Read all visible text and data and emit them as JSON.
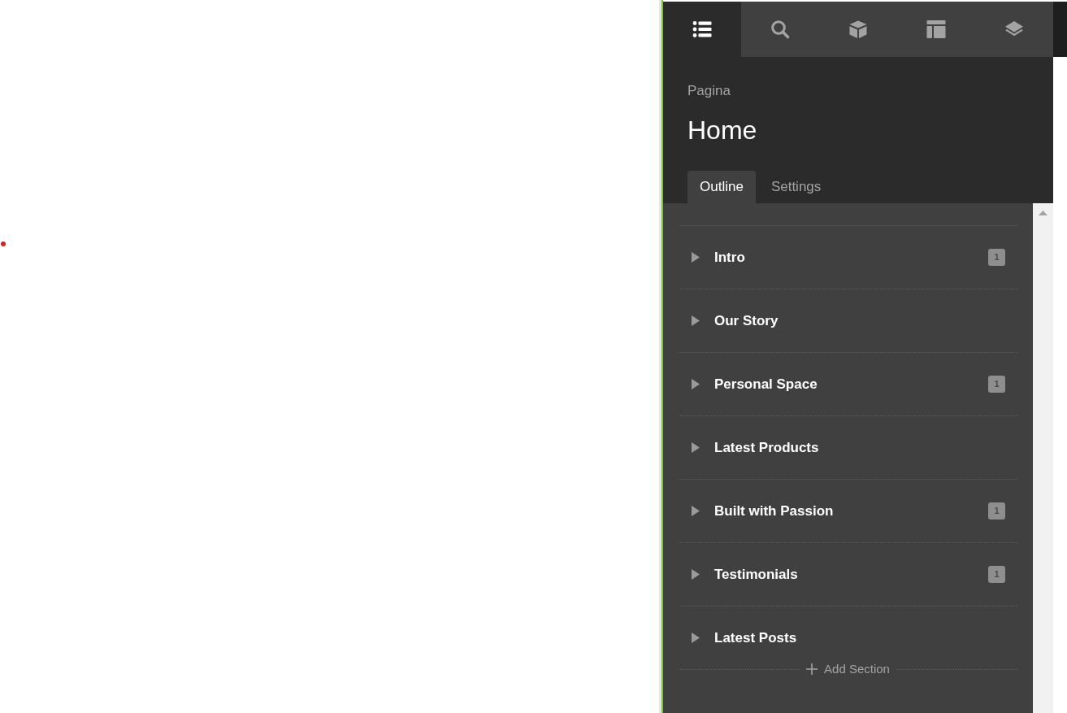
{
  "toolbar": {
    "tabs": [
      {
        "kind": "outline",
        "selected": true
      },
      {
        "kind": "search",
        "selected": false
      },
      {
        "kind": "blocks",
        "selected": false
      },
      {
        "kind": "layout",
        "selected": false
      },
      {
        "kind": "layers",
        "selected": false
      }
    ]
  },
  "header": {
    "label": "Pagina",
    "title": "Home"
  },
  "tabs": [
    {
      "label": "Outline",
      "selected": true
    },
    {
      "label": "Settings",
      "selected": false
    }
  ],
  "sections": [
    {
      "name": "Intro",
      "expanded": false,
      "badge": "1"
    },
    {
      "name": "Our Story",
      "expanded": false
    },
    {
      "name": "Personal Space",
      "expanded": false,
      "badge": "1"
    },
    {
      "name": "Latest Products",
      "expanded": false
    },
    {
      "name": "Built with Passion",
      "expanded": false,
      "badge": "1"
    },
    {
      "name": "Testimonials",
      "expanded": false,
      "badge": "1"
    },
    {
      "name": "Latest Posts",
      "expanded": false
    }
  ],
  "add_section": {
    "label": "Add Section"
  }
}
